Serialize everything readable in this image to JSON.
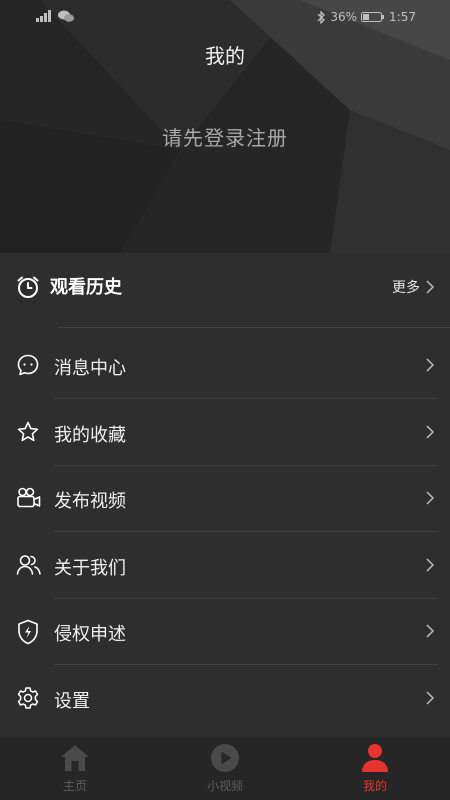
{
  "status_bar": {
    "battery": "36%",
    "time": "1:57"
  },
  "header": {
    "title": "我的",
    "login_prompt": "请先登录注册"
  },
  "history": {
    "title": "观看历史",
    "more_label": "更多"
  },
  "menu": [
    {
      "label": "消息中心",
      "icon": "chat-bubble-icon"
    },
    {
      "label": "我的收藏",
      "icon": "star-icon"
    },
    {
      "label": "发布视频",
      "icon": "video-camera-icon"
    },
    {
      "label": "关于我们",
      "icon": "users-icon"
    },
    {
      "label": "侵权申述",
      "icon": "shield-bolt-icon"
    },
    {
      "label": "设置",
      "icon": "gear-icon"
    }
  ],
  "bottom_nav": {
    "active_color": "#e8342f",
    "items": [
      {
        "label": "主页",
        "icon": "home-icon"
      },
      {
        "label": "小视频",
        "icon": "play-circle-icon"
      },
      {
        "label": "我的",
        "icon": "profile-icon"
      }
    ]
  }
}
